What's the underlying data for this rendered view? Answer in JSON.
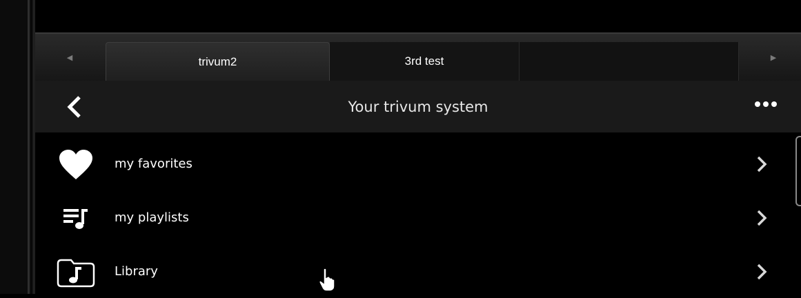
{
  "tabs": {
    "items": [
      {
        "label": "trivum2",
        "active": true
      },
      {
        "label": "3rd test",
        "active": false
      },
      {
        "label": "",
        "active": false
      }
    ],
    "prev_icon": "triangle-left-icon",
    "next_icon": "triangle-right-icon"
  },
  "header": {
    "title": "Your trivum system",
    "back_icon": "chevron-left-icon",
    "more_icon": "more-dots-icon"
  },
  "list": {
    "items": [
      {
        "label": "my favorites",
        "icon": "heart-icon"
      },
      {
        "label": "my playlists",
        "icon": "playlist-icon"
      },
      {
        "label": "Library",
        "icon": "music-folder-icon"
      }
    ]
  },
  "colors": {
    "background": "#000000",
    "header_bg": "#1a1a1a",
    "tab_bar_bg": "#1e1e1e",
    "text": "#ffffff"
  }
}
